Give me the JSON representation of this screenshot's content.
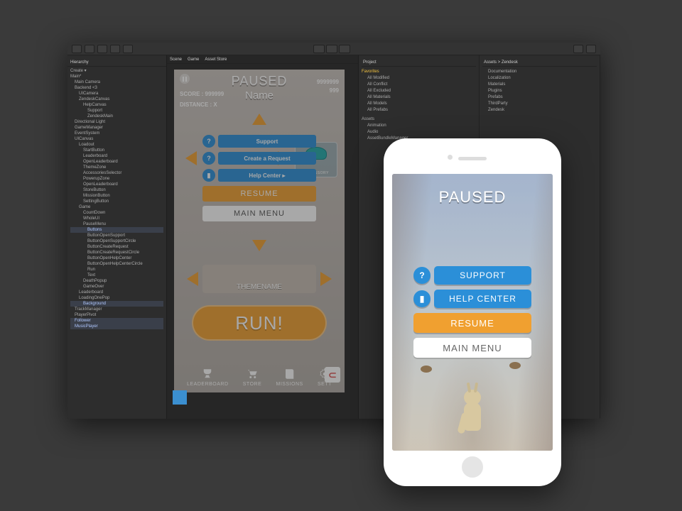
{
  "colors": {
    "accent_orange": "#f0a030",
    "accent_blue": "#2b8fd8",
    "panel": "#2d2d2d"
  },
  "unity": {
    "hierarchy_tab": "Hierarchy",
    "scene_tabs": [
      "Scene",
      "Game",
      "Asset Store"
    ],
    "project_tab": "Project",
    "tree": {
      "root": "Main*",
      "items": [
        "Main Camera",
        "Backend <3",
        "UICamera",
        "ZendeskCanvas",
        "HelpCanvas",
        "Support",
        "ZendeskMain",
        "Directional Light",
        "GameManager",
        "EventSystem",
        "UICanvas",
        "Loadout",
        "StartButton",
        "Leaderboard",
        "OpenLeaderboard",
        "ThemeZone",
        "AccessoriesSelector",
        "PowerupZone",
        "OpenLeaderboard",
        "StoreButton",
        "MissionButton",
        "SettingButton",
        "Game",
        "CountDown",
        "WholeUI",
        "PauseMenu",
        "Buttons",
        "ButtonOpenSupport",
        "ButtonOpenSupportCircle",
        "ButtonCreateRequest",
        "ButtonCreateRequestCircle",
        "ButtonOpenHelpCenter",
        "ButtonOpenHelpCenterCircle",
        "Run",
        "Text",
        "DeathPopup",
        "GameOver",
        "Leaderboard",
        "LoadingOnePop",
        "Background",
        "TrackManager",
        "PlayerPivot",
        "Follower",
        "MusicPlayer"
      ]
    },
    "favorites": {
      "label": "Favorites",
      "items": [
        "All Modified",
        "All Conflict",
        "All Excluded",
        "All Materials",
        "All Models",
        "All Prefabs"
      ]
    },
    "assets": {
      "label": "Assets",
      "items": [
        "Animation",
        "Audio",
        "AssetBundleManager"
      ]
    },
    "assets_view": {
      "label": "Assets > Zendesk",
      "items": [
        "Documentation",
        "Localization",
        "Materials",
        "Plugins",
        "Prefabs",
        "ThirdParty",
        "Zendesk"
      ]
    }
  },
  "scene": {
    "paused": "PAUSED",
    "name": "Name",
    "score_label": "SCORE : 999999",
    "distance_label": "DISTANCE : X",
    "num1": "9999999",
    "num2": "999",
    "accessory": "ACCESSORY",
    "support": "Support",
    "create_request": "Create a Request",
    "help_center": "Help Center ▸",
    "resume": "RESUME",
    "main_menu": "MAIN MENU",
    "theme": "THEMENAME",
    "run": "RUN!",
    "nav": {
      "leaderboard": "LEADERBOARD",
      "store": "STORE",
      "missions": "MISSIONS",
      "settings": "SETT"
    }
  },
  "phone": {
    "paused": "PAUSED",
    "support": "SUPPORT",
    "help_center": "HELP CENTER",
    "resume": "RESUME",
    "main_menu": "MAIN MENU"
  }
}
